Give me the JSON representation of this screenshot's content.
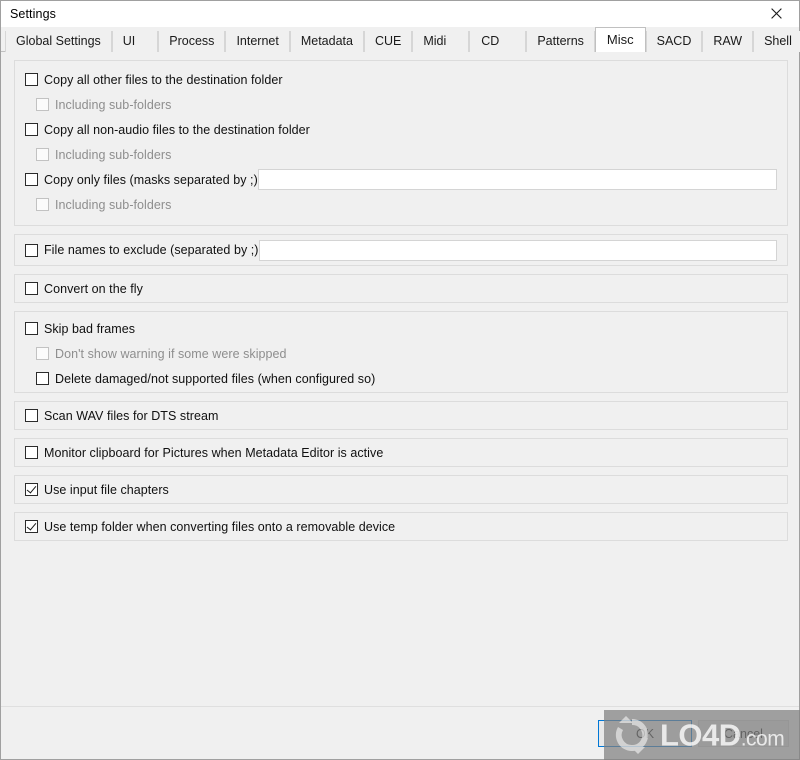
{
  "window": {
    "title": "Settings",
    "close_icon": "close-icon"
  },
  "tabs": [
    {
      "label": "Global Settings",
      "selected": false
    },
    {
      "label": "UI",
      "selected": false
    },
    {
      "label": "Process",
      "selected": false
    },
    {
      "label": "Internet",
      "selected": false
    },
    {
      "label": "Metadata",
      "selected": false
    },
    {
      "label": "CUE",
      "selected": false
    },
    {
      "label": "Midi",
      "selected": false
    },
    {
      "label": "CD",
      "selected": false
    },
    {
      "label": "Patterns",
      "selected": false
    },
    {
      "label": "Misc",
      "selected": true
    },
    {
      "label": "SACD",
      "selected": false
    },
    {
      "label": "RAW",
      "selected": false
    },
    {
      "label": "Shell",
      "selected": false
    }
  ],
  "groups": [
    {
      "name": "copy-files-group",
      "rows": [
        {
          "label": "Copy all other files to the destination folder",
          "checked": false,
          "disabled": false,
          "sub": false
        },
        {
          "label": "Including sub-folders",
          "checked": false,
          "disabled": true,
          "sub": true
        },
        {
          "label": "Copy all non-audio files to the destination folder",
          "checked": false,
          "disabled": false,
          "sub": false
        },
        {
          "label": "Including sub-folders",
          "checked": false,
          "disabled": true,
          "sub": true
        },
        {
          "label": "Copy only files (masks separated by ;)",
          "checked": false,
          "disabled": false,
          "sub": false,
          "input": {
            "value": "",
            "placeholder": ""
          }
        },
        {
          "label": "Including sub-folders",
          "checked": false,
          "disabled": true,
          "sub": true
        }
      ]
    },
    {
      "name": "exclude-group",
      "rows": [
        {
          "label": "File names to exclude (separated by ;)",
          "checked": false,
          "disabled": false,
          "sub": false,
          "input": {
            "value": "",
            "placeholder": ""
          }
        }
      ]
    },
    {
      "name": "convert-group",
      "rows": [
        {
          "label": "Convert on the fly",
          "checked": false,
          "disabled": false,
          "sub": false
        }
      ]
    },
    {
      "name": "bad-frames-group",
      "rows": [
        {
          "label": "Skip bad frames",
          "checked": false,
          "disabled": false,
          "sub": false
        },
        {
          "label": "Don't show warning if some were skipped",
          "checked": false,
          "disabled": true,
          "sub": true
        },
        {
          "label": "Delete damaged/not supported files (when configured so)",
          "checked": false,
          "disabled": false,
          "sub": true
        }
      ]
    },
    {
      "name": "dts-group",
      "rows": [
        {
          "label": "Scan WAV files for DTS stream",
          "checked": false,
          "disabled": false,
          "sub": false
        }
      ]
    },
    {
      "name": "clipboard-group",
      "rows": [
        {
          "label": "Monitor clipboard for Pictures when Metadata Editor is active",
          "checked": false,
          "disabled": false,
          "sub": false
        }
      ]
    },
    {
      "name": "chapters-group",
      "rows": [
        {
          "label": "Use input file chapters",
          "checked": true,
          "disabled": false,
          "sub": false
        }
      ]
    },
    {
      "name": "temp-folder-group",
      "rows": [
        {
          "label": "Use temp folder when converting files onto a removable device",
          "checked": true,
          "disabled": false,
          "sub": false
        }
      ]
    }
  ],
  "buttons": {
    "ok_label": "OK",
    "cancel_label": "Cancel"
  },
  "watermark": {
    "brand": "LO4D",
    "domain": ".com",
    "logo_icon": "refresh-circular-arrows-icon"
  },
  "colors": {
    "window_background": "#f0f0f0",
    "panel_border": "#dcdcdc",
    "titlebar_background": "#ffffff",
    "selected_tab_background": "#ffffff",
    "focus_border": "#0078d7",
    "text": "#101010",
    "disabled_text": "#8e8e8e",
    "input_background": "#ffffff"
  }
}
